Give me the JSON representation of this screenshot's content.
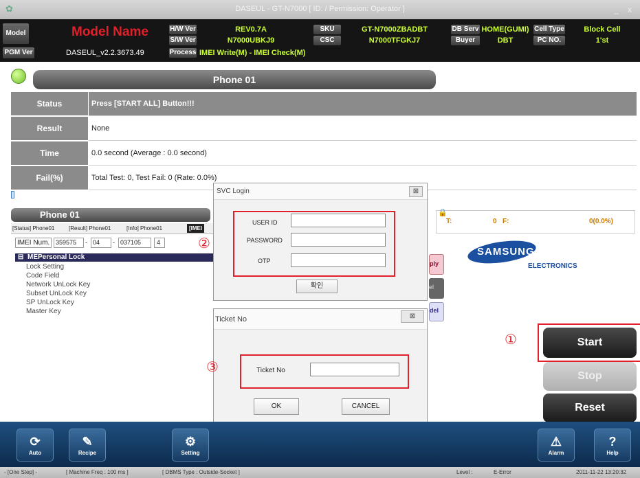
{
  "window": {
    "title": "DASEUL - GT-N7000 [ ID: / Permission: Operator ]",
    "min_glyph": "_",
    "close_glyph": "x"
  },
  "info": {
    "model_label": "Model",
    "model_name": "Model Name",
    "pgm_label": "PGM Ver",
    "pgm_value": "DASEUL_v2.2.3673.49",
    "hw_label": "H/W Ver",
    "hw_value": "REV0.7A",
    "sw_label": "S/W Ver",
    "sw_value": "N7000UBKJ9",
    "process_label": "Process",
    "process_value": "IMEI Write(M) - IMEI Check(M)",
    "sku_label": "SKU",
    "sku_value": "GT-N7000ZBADBT",
    "csc_label": "CSC",
    "csc_value": "N7000TFGKJ7",
    "dbserv_label": "DB Serv",
    "dbserv_value": "HOME(GUMI)",
    "buyer_label": "Buyer",
    "buyer_value": "DBT",
    "celltype_label": "Cell Type",
    "celltype_value": "Block Cell",
    "pcno_label": "PC NO.",
    "pcno_value": "1'st"
  },
  "phone_header": "Phone 01",
  "status_rows": [
    {
      "key": "Status",
      "value": "Press [START ALL] Button!!!"
    },
    {
      "key": "Result",
      "value": "None"
    },
    {
      "key": "Time",
      "value": "0.0 second (Average : 0.0 second)"
    },
    {
      "key": "Fail(%)",
      "value": "Total Test: 0, Test Fail: 0 (Rate: 0.0%)"
    }
  ],
  "lower": {
    "phone_tab": "Phone 01",
    "tabs": [
      "[Status] Phone01",
      "[Result] Phone01",
      "[Info] Phone01",
      "[IMEI"
    ],
    "imei_label": "IMEI Num.",
    "imei_parts": [
      "359575",
      "04",
      "037105",
      "4"
    ],
    "tree_header": "MEPersonal Lock",
    "tree_items": [
      "Lock Setting",
      "Code Field",
      "Network UnLock Key",
      "Subset UnLock Key",
      "SP UnLock Key",
      "Master Key"
    ]
  },
  "right": {
    "t_label": "T:",
    "t_value": "0",
    "f_label": "F:",
    "f_value": "0(0.0%)",
    "brand": "SAMSUNG",
    "brand_sub": "ELECTRONICS",
    "partial_apply": "ply",
    "partial_del": "el",
    "partial_model": "del",
    "start_label": "Start",
    "stop_label": "Stop",
    "reset_label": "Reset"
  },
  "svc_login": {
    "title": "SVC Login",
    "close": "⊠",
    "user_label": "USER ID",
    "password_label": "PASSWORD",
    "otp_label": "OTP",
    "confirm_label": "확인"
  },
  "ticket": {
    "title": "Ticket No",
    "close": "⊠",
    "field_label": "Ticket No",
    "ok_label": "OK",
    "cancel_label": "CANCEL"
  },
  "annotations": {
    "one": "①",
    "two": "②",
    "three": "③"
  },
  "toolbar": {
    "auto": "Auto",
    "recipe": "Recipe",
    "setting": "Setting",
    "alarm": "Alarm",
    "help": "Help"
  },
  "statusbar": {
    "one_step": "- [One Step] -",
    "machine_freq": "[ Machine Freq : 100 ms ]",
    "dbms": "[ DBMS Type : Outside-Socket ]",
    "level": "Level :",
    "error": "E-Error",
    "datetime": "2011-11-22 13:20:32"
  },
  "colors": {
    "accent_green": "#ccff33",
    "model_red": "#e0202a",
    "toolbar_blue": "#1f4f7f"
  }
}
